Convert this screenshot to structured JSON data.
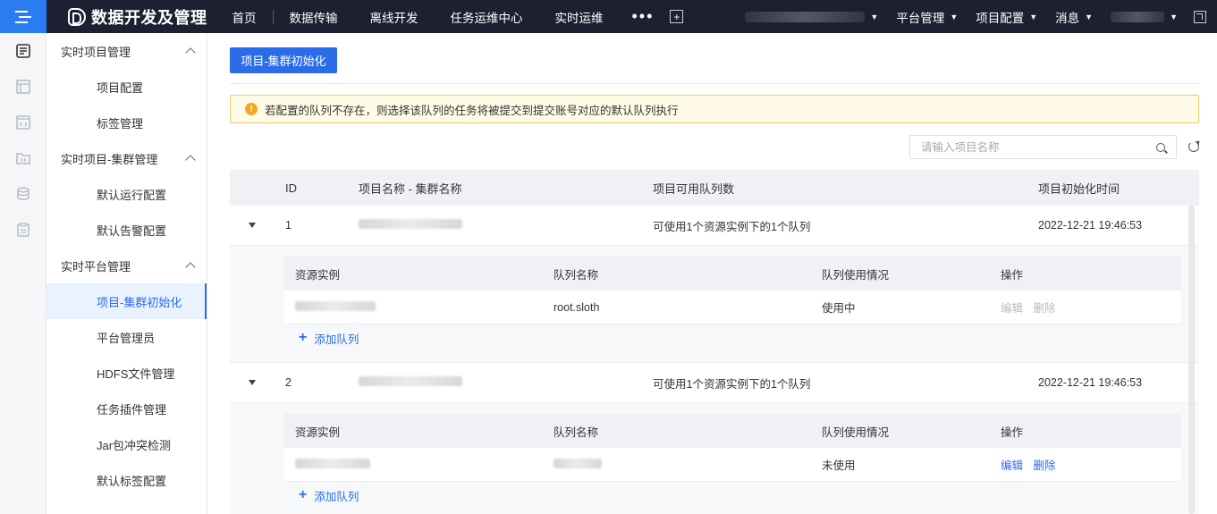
{
  "topbar": {
    "brand": "数据开发及管理",
    "nav": [
      "首页",
      "数据传输",
      "离线开发",
      "任务运维中心",
      "实时运维"
    ],
    "more": "•••",
    "plus": "+",
    "platform_label": "平台管理",
    "project_config_label": "项目配置",
    "messages_label": "消息"
  },
  "sidebar": {
    "groups": [
      {
        "title": "实时项目管理",
        "items": [
          "项目配置",
          "标签管理"
        ]
      },
      {
        "title": "实时项目-集群管理",
        "items": [
          "默认运行配置",
          "默认告警配置"
        ]
      },
      {
        "title": "实时平台管理",
        "items": [
          "项目-集群初始化",
          "平台管理员",
          "HDFS文件管理",
          "任务插件管理",
          "Jar包冲突检测",
          "默认标签配置"
        ]
      }
    ],
    "active_item": "项目-集群初始化"
  },
  "main": {
    "init_button": "项目-集群初始化",
    "alert_icon": "!",
    "alert": "若配置的队列不存在，则选择该队列的任务将被提交到提交账号对应的默认队列执行",
    "search_placeholder": "请输入项目名称"
  },
  "table": {
    "headers": {
      "id": "ID",
      "name": "项目名称 - 集群名称",
      "count": "项目可用队列数",
      "time": "项目初始化时间"
    },
    "sub_headers": {
      "instance": "资源实例",
      "queue": "队列名称",
      "usage": "队列使用情况",
      "ops": "操作"
    },
    "add_queue": "添加队列",
    "rows": [
      {
        "id": "1",
        "count": "可使用1个资源实例下的1个队列",
        "time": "2022-12-21 19:46:53",
        "queue": {
          "name": "root.sloth",
          "usage": "使用中",
          "edit": "编辑",
          "delete": "删除",
          "ops_enabled": false
        }
      },
      {
        "id": "2",
        "count": "可使用1个资源实例下的1个队列",
        "time": "2022-12-21 19:46:53",
        "queue": {
          "name": "",
          "usage": "未使用",
          "edit": "编辑",
          "delete": "删除",
          "ops_enabled": true
        }
      }
    ]
  },
  "colors": {
    "primary": "#2b6de8",
    "topbar": "#1c2030",
    "warning": "#f5a623"
  }
}
